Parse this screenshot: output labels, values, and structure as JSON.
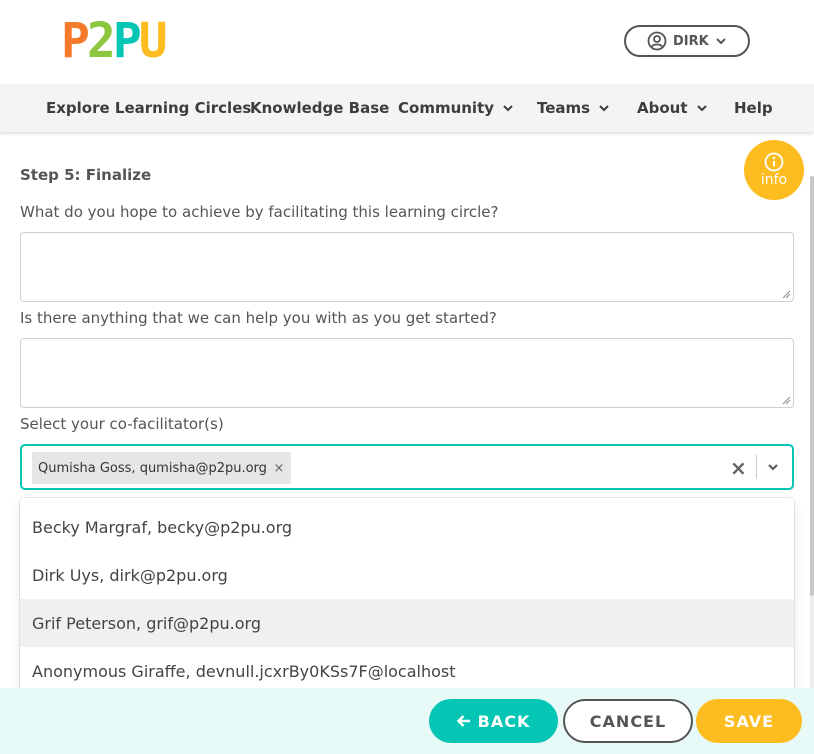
{
  "header": {
    "logo_letters": [
      "P",
      "2",
      "P",
      "U"
    ],
    "logo_colors": [
      "#f57a2b",
      "#8cc63f",
      "#05c6b4",
      "#fdbc20"
    ],
    "user_label": "DIRK",
    "user_icon": "user-circle-icon"
  },
  "nav": {
    "items": [
      {
        "label": "Explore Learning Circles",
        "dropdown": false
      },
      {
        "label": "Knowledge Base",
        "dropdown": false
      },
      {
        "label": "Community",
        "dropdown": true
      },
      {
        "label": "Teams",
        "dropdown": true
      },
      {
        "label": "About",
        "dropdown": true
      },
      {
        "label": "Help",
        "dropdown": false
      }
    ]
  },
  "main": {
    "step_title": "Step 5: Finalize",
    "q1_label": "What do you hope to achieve by facilitating this learning circle?",
    "q1_value": "",
    "q2_label": "Is there anything that we can help you with as you get started?",
    "q2_value": "",
    "cofacilitator_label": "Select your co-facilitator(s)",
    "selected_chip": "Qumisha Goss, qumisha@p2pu.org",
    "chip_remove": "×",
    "clear_symbol": "×",
    "options": [
      "Becky Margraf, becky@p2pu.org",
      "Dirk Uys, dirk@p2pu.org",
      "Grif Peterson, grif@p2pu.org",
      "Anonymous Giraffe, devnull.jcxrBy0KSs7F@localhost"
    ],
    "highlighted_option": 2
  },
  "info_button": {
    "label": "info",
    "icon": "info-circle-icon",
    "color": "#fdbc20"
  },
  "footer": {
    "back_label": "BACK",
    "cancel_label": "CANCEL",
    "save_label": "SAVE"
  },
  "colors": {
    "accent_teal": "#05c6b4",
    "accent_yellow": "#fdbc20",
    "footer_bg": "#e8faf7"
  }
}
